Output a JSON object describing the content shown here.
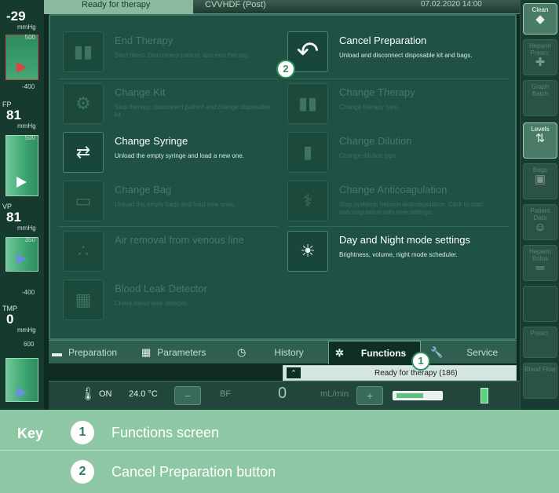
{
  "colors": {
    "screen_bg": "#0e2a22",
    "dialog_bg": "#1f5244",
    "key_bg": "#8ec7a3",
    "callout_green": "#2f8f5c",
    "gauge_green": "#3fa873"
  },
  "top_bar": {
    "status": "Ready for therapy",
    "mode": "CVVHDF (Post)",
    "date": "07.02.2020 14:00"
  },
  "left_pressures": [
    {
      "label": "",
      "value": "-29",
      "unit": "mmHg",
      "tick_top": "500",
      "tick_bottom": "-400"
    },
    {
      "label": "FP",
      "value": "81",
      "unit": "mmHg",
      "tick_top": "500",
      "tick_bottom": ""
    },
    {
      "label": "VP",
      "value": "81",
      "unit": "mmHg",
      "tick_top": "350",
      "tick_bottom": "-400"
    },
    {
      "label": "TMP",
      "value": "0",
      "unit": "mmHg",
      "tick_top": "600",
      "tick_bottom": ""
    }
  ],
  "functions": [
    {
      "id": "end-therapy",
      "icon": "end-therapy-icon",
      "glyph": "▮▮",
      "title": "End Therapy",
      "desc": "Start tiltest. Disconnect patient, and end therapy.",
      "enabled": false
    },
    {
      "id": "cancel-preparation",
      "icon": "back-arrow-icon",
      "glyph": "↶",
      "title": "Cancel Preparation",
      "desc": "Unload and disconnect disposable kit and bags.",
      "enabled": true
    },
    {
      "id": "change-kit",
      "icon": "change-kit-icon",
      "glyph": "⚙",
      "title": "Change Kit",
      "desc": "Stop therapy, disconnect patient and change disposable kit.",
      "enabled": false
    },
    {
      "id": "change-therapy",
      "icon": "change-therapy-icon",
      "glyph": "▮▮",
      "title": "Change Therapy",
      "desc": "Change therapy type.",
      "enabled": false
    },
    {
      "id": "change-syringe",
      "icon": "syringe-icon",
      "glyph": "⇄",
      "title": "Change Syringe",
      "desc": "Unload the empty syringe and load a new one.",
      "enabled": true
    },
    {
      "id": "change-dilution",
      "icon": "dilution-icon",
      "glyph": "▮",
      "title": "Change Dilution",
      "desc": "Change dilution type.",
      "enabled": false
    },
    {
      "id": "change-bag",
      "icon": "bag-icon",
      "glyph": "▭",
      "title": "Change Bag",
      "desc": "Unload the empty bags and load new ones.",
      "enabled": false
    },
    {
      "id": "change-anticoagulation",
      "icon": "anticoagulation-icon",
      "glyph": "⚕",
      "title": "Change Anticoagulation",
      "desc": "Stop systemic heparin anticoagulation. Click to start anticoagulation with new settings.",
      "enabled": false
    },
    {
      "id": "air-removal",
      "icon": "air-removal-icon",
      "glyph": "∴",
      "title": "Air removal from venous line",
      "desc": "",
      "enabled": false
    },
    {
      "id": "day-night-mode",
      "icon": "day-night-icon",
      "glyph": "☀",
      "title": "Day and Night mode settings",
      "desc": "Brightness, volume, night mode scheduler.",
      "enabled": true
    },
    {
      "id": "blood-leak",
      "icon": "blood-leak-icon",
      "glyph": "▦",
      "title": "Blood Leak Detector",
      "desc": "Check blood leak detector.",
      "enabled": false
    }
  ],
  "tabs": [
    {
      "label": "Preparation",
      "icon": "preparation-icon",
      "glyph": "▬",
      "active": false
    },
    {
      "label": "Parameters",
      "icon": "calculator-icon",
      "glyph": "▦",
      "active": false
    },
    {
      "label": "History",
      "icon": "history-icon",
      "glyph": "◷",
      "active": false
    },
    {
      "label": "Functions",
      "icon": "gear-icon",
      "glyph": "✲",
      "active": true
    },
    {
      "label": "Service",
      "icon": "wrench-icon",
      "glyph": "🔧",
      "active": false
    }
  ],
  "status_strip": {
    "chevron": "⌃",
    "text": "Ready for therapy (186)"
  },
  "bottom_bar": {
    "heater_state": "ON",
    "temperature": "24.0 °C",
    "minus": "−",
    "bf_label": "BF",
    "flow_value": "0",
    "flow_unit": "mL/min",
    "plus": "+"
  },
  "right_buttons": [
    {
      "label": "Clean",
      "icon": "clean-icon",
      "glyph": "◆",
      "state": "active"
    },
    {
      "label": "Heparin Prescr.",
      "icon": "heparin-icon",
      "glyph": "✚",
      "state": "dim"
    },
    {
      "label": "Graph Batch",
      "icon": "graph-icon",
      "glyph": "",
      "state": "dim"
    },
    {
      "label": "Levels",
      "icon": "levels-icon",
      "glyph": "⇅",
      "state": "active"
    },
    {
      "label": "Bags",
      "icon": "bags-icon",
      "glyph": "▣",
      "state": "dim"
    },
    {
      "label": "Patient Data",
      "icon": "patient-icon",
      "glyph": "☺",
      "state": "dim"
    },
    {
      "label": "Heparin Bolus",
      "icon": "bolus-icon",
      "glyph": "═",
      "state": "dim"
    },
    {
      "label": "",
      "icon": "blank-icon",
      "glyph": "",
      "state": "dim"
    },
    {
      "label": "Prescr.",
      "icon": "prescr-icon",
      "glyph": "",
      "state": "dim"
    },
    {
      "label": "Blood Flow",
      "icon": "blood-flow-icon",
      "glyph": "",
      "state": "dim"
    }
  ],
  "callouts": {
    "one": "1",
    "two": "2"
  },
  "key": {
    "title": "Key",
    "items": [
      {
        "num": "1",
        "label": "Functions screen"
      },
      {
        "num": "2",
        "label": "Cancel Preparation button"
      }
    ]
  }
}
